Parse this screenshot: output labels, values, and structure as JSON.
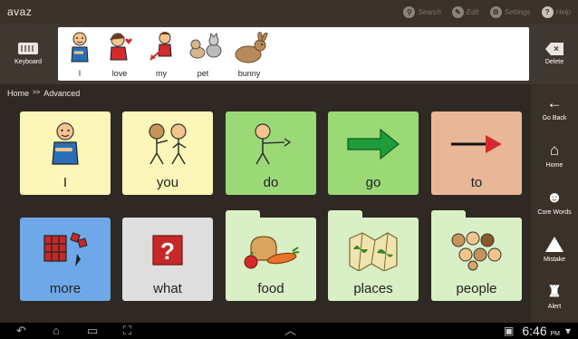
{
  "app": {
    "logo": "avaz"
  },
  "topbar": {
    "actions": [
      {
        "label": "Search",
        "glyph": "search-icon"
      },
      {
        "label": "Edit",
        "glyph": "edit-icon"
      },
      {
        "label": "Settings",
        "glyph": "gear-icon"
      },
      {
        "label": "Help",
        "glyph": "help-icon"
      }
    ]
  },
  "message": {
    "keyboard_label": "Keyboard",
    "delete_label": "Delete",
    "words": [
      "I",
      "love",
      "my",
      "pet",
      "bunny"
    ]
  },
  "breadcrumb": {
    "home": "Home",
    "separator": ">>",
    "current": "Advanced"
  },
  "tiles": [
    {
      "label": "I",
      "color": "#fcf6b8"
    },
    {
      "label": "you",
      "color": "#fcf6b8"
    },
    {
      "label": "do",
      "color": "#9bd977"
    },
    {
      "label": "go",
      "color": "#9bd977"
    },
    {
      "label": "to",
      "color": "#e8b797"
    },
    {
      "label": "more",
      "color": "#6fa8e8"
    },
    {
      "label": "what",
      "color": "#dedede"
    },
    {
      "label": "food",
      "color": "#d9efc5"
    },
    {
      "label": "places",
      "color": "#d9efc5"
    },
    {
      "label": "people",
      "color": "#d9efc5"
    }
  ],
  "sidebar": {
    "items": [
      {
        "label": "Go Back",
        "glyph": "←"
      },
      {
        "label": "Home",
        "glyph": "⌂"
      },
      {
        "label": "Core Words",
        "glyph": "☻"
      },
      {
        "label": "Mistake",
        "glyph": "!"
      },
      {
        "label": "Alert",
        "glyph": "♜"
      }
    ]
  },
  "status": {
    "time": "6:46",
    "ampm": "PM"
  }
}
